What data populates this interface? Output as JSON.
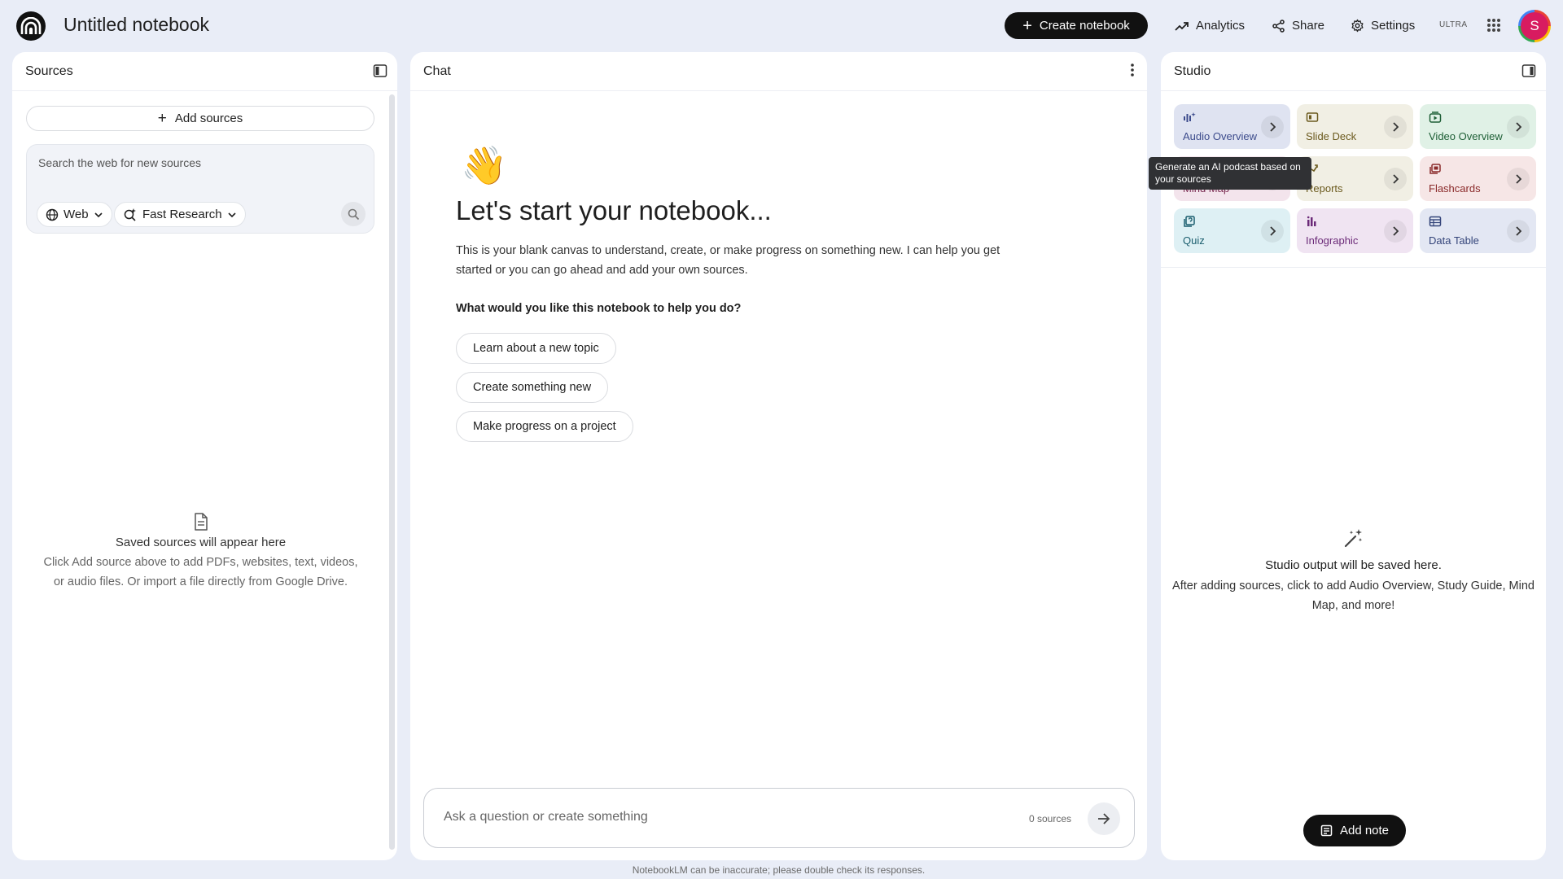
{
  "header": {
    "notebook_title": "Untitled notebook",
    "create_label": "Create notebook",
    "analytics_label": "Analytics",
    "share_label": "Share",
    "settings_label": "Settings",
    "tier_badge": "ULTRA",
    "avatar_initial": "S"
  },
  "sources": {
    "title": "Sources",
    "add_label": "Add sources",
    "search_placeholder": "Search the web for new sources",
    "source_type": "Web",
    "research_mode": "Fast Research",
    "empty_title": "Saved sources will appear here",
    "empty_desc": "Click Add source above to add PDFs, websites, text, videos, or audio files. Or import a file directly from Google Drive."
  },
  "chat": {
    "title": "Chat",
    "heading": "Let's start your notebook...",
    "intro": "This is your blank canvas to understand, create, or make progress on something new. I can help you get started or you can go ahead and add your own sources.",
    "question": "What would you like this notebook to help you do?",
    "suggestions": [
      "Learn about a new topic",
      "Create something new",
      "Make progress on a project"
    ],
    "input_placeholder": "Ask a question or create something",
    "source_count": "0 sources",
    "disclaimer": "NotebookLM can be inaccurate; please double check its responses."
  },
  "studio": {
    "title": "Studio",
    "tiles": [
      {
        "label": "Audio Overview",
        "bg": "#dfe3f1",
        "fg": "#3c4b8c",
        "icon": "audio-icon"
      },
      {
        "label": "Slide Deck",
        "bg": "#f1efe4",
        "fg": "#6b5a1e",
        "icon": "slides-icon"
      },
      {
        "label": "Video Overview",
        "bg": "#e0f1e6",
        "fg": "#1e5f36",
        "icon": "video-icon"
      },
      {
        "label": "Mind Map",
        "bg": "#f3e4ec",
        "fg": "#7a2c52",
        "icon": "mind-map-icon"
      },
      {
        "label": "Reports",
        "bg": "#f1efe4",
        "fg": "#6b5a1e",
        "icon": "reports-icon"
      },
      {
        "label": "Flashcards",
        "bg": "#f6e6e6",
        "fg": "#8a2a2a",
        "icon": "flashcards-icon"
      },
      {
        "label": "Quiz",
        "bg": "#def0f4",
        "fg": "#1b5e6e",
        "icon": "quiz-icon"
      },
      {
        "label": "Infographic",
        "bg": "#f0e4f2",
        "fg": "#6b2a78",
        "icon": "infographic-icon"
      },
      {
        "label": "Data Table",
        "bg": "#e3e7f3",
        "fg": "#34457a",
        "icon": "table-icon"
      }
    ],
    "tooltip": "Generate an AI podcast based on your sources",
    "empty_title": "Studio output will be saved here.",
    "empty_desc": "After adding sources, click to add Audio Overview, Study Guide, Mind Map, and more!",
    "add_note_label": "Add note"
  }
}
